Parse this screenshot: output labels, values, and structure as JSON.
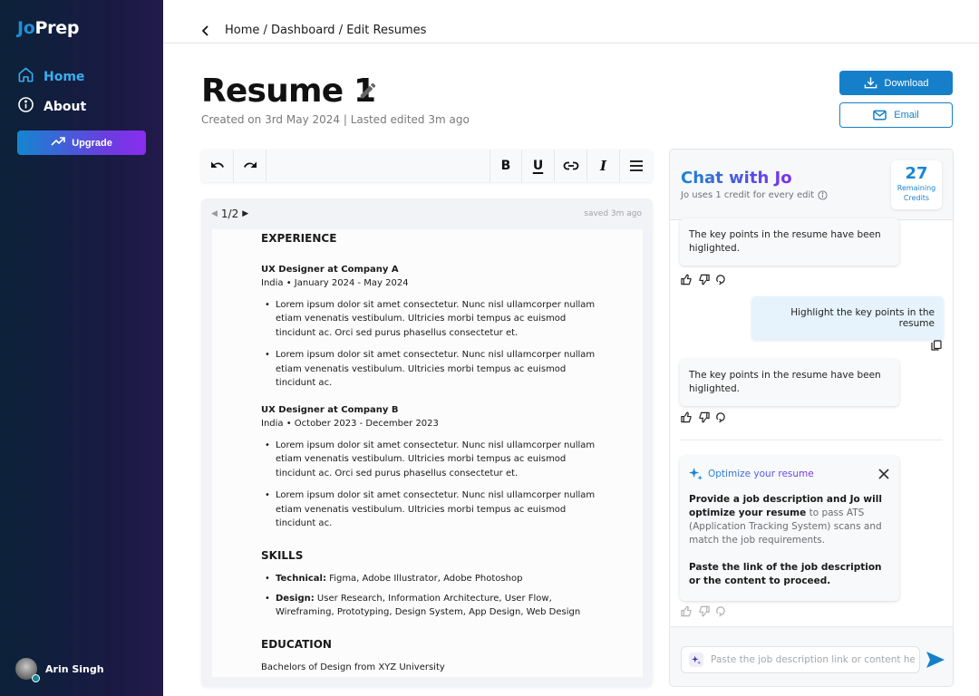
{
  "app": {
    "logo_part1": "Jo",
    "logo_part2": "Prep"
  },
  "sidebar": {
    "items": [
      {
        "label": "Home",
        "icon": "home-icon",
        "active": true
      },
      {
        "label": "About",
        "icon": "info-icon",
        "active": false
      }
    ],
    "upgrade_label": "Upgrade",
    "user": {
      "name": "Arin Singh",
      "status": "online"
    }
  },
  "header": {
    "breadcrumb": "Home / Dashboard / Edit Resumes"
  },
  "document": {
    "title": "Resume 1",
    "meta": "Created on 3rd May 2024 | Lasted edited 3m ago",
    "download_label": "Download",
    "email_label": "Email"
  },
  "toolbar": {
    "buttons": [
      "undo",
      "redo",
      "bold",
      "underline",
      "link",
      "italic",
      "align"
    ],
    "bold_glyph": "B",
    "underline_glyph": "U",
    "italic_glyph": "I"
  },
  "editor": {
    "page_indicator": "1/2",
    "saved_status": "saved 3m ago",
    "resume": {
      "experience_heading": "EXPERIENCE",
      "jobs": [
        {
          "title": "UX Designer at Company A",
          "meta": "India • January 2024 - May 2024",
          "bullets": [
            "Lorem ipsum dolor sit amet consectetur. Nunc nisl ullamcorper nullam etiam venenatis vestibulum. Ultricies morbi tempus ac euismod tincidunt ac. Orci sed purus phasellus consectetur et.",
            "Lorem ipsum dolor sit amet consectetur. Nunc nisl ullamcorper nullam etiam venenatis vestibulum. Ultricies morbi tempus ac euismod tincidunt ac."
          ]
        },
        {
          "title": "UX Designer at Company B",
          "meta": "India • October 2023 - December 2023",
          "bullets": [
            "Lorem ipsum dolor sit amet consectetur. Nunc nisl ullamcorper nullam etiam venenatis vestibulum. Ultricies morbi tempus ac euismod tincidunt ac. Orci sed purus phasellus consectetur et.",
            "Lorem ipsum dolor sit amet consectetur. Nunc nisl ullamcorper nullam etiam venenatis vestibulum. Ultricies morbi tempus ac euismod tincidunt ac."
          ]
        }
      ],
      "skills_heading": "SKILLS",
      "skills": [
        {
          "label": "Technical:",
          "value": " Figma, Adobe Illustrator, Adobe Photoshop"
        },
        {
          "label": "Design:",
          "value": " User Research, Information Architecture, User Flow, Wireframing, Prototyping, Design System, App Design, Web Design"
        }
      ],
      "education_heading": "EDUCATION",
      "education": "Bachelors of Design from XYZ University"
    }
  },
  "chat": {
    "title": "Chat with Jo",
    "subtitle": "Jo uses 1 credit for every edit",
    "credits_count": "27",
    "credits_label_1": "Remaining",
    "credits_label_2": "Credits",
    "messages": [
      {
        "role": "bot",
        "text": "The key points in the resume have been higlighted."
      },
      {
        "role": "user",
        "text": "Highlight the key points in the resume"
      },
      {
        "role": "bot",
        "text": "The key points in the resume have been higlighted."
      }
    ],
    "optimize_card": {
      "title": "Optimize your resume",
      "para1_bold": "Provide a job description and Jo will optimize your resume",
      "para1_rest": " to pass ATS (Application Tracking System) scans and match the job requirements.",
      "para2": "Paste the link of the job description or the content to proceed."
    },
    "input_placeholder": "Paste the job description link or content here",
    "input_value": ""
  },
  "colors": {
    "brand_blue": "#1580c9",
    "brand_purple": "#7b2ff0",
    "sidebar_bg": "#0b2238",
    "user_bubble": "#e6f3fd"
  }
}
